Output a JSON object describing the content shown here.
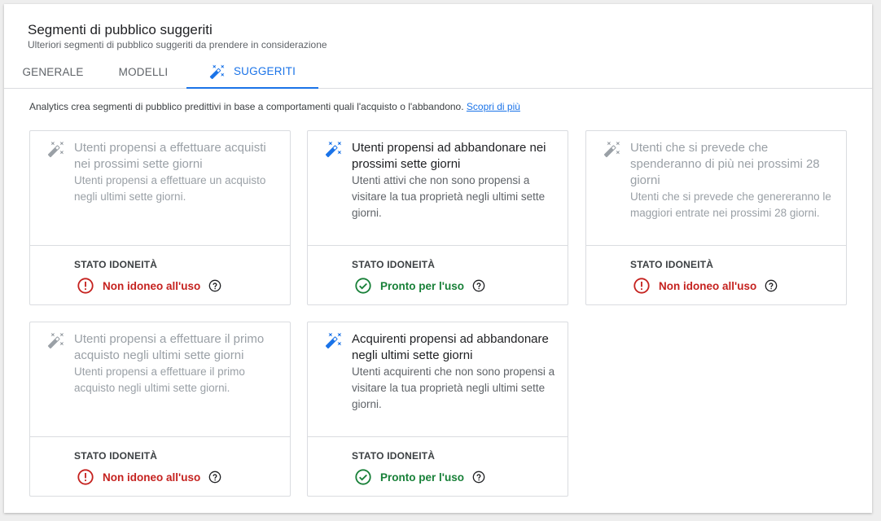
{
  "header": {
    "title": "Segmenti di pubblico suggeriti",
    "subtitle": "Ulteriori segmenti di pubblico suggeriti da prendere in considerazione"
  },
  "tabs": [
    {
      "label": "GENERALE",
      "active": false
    },
    {
      "label": "MODELLI",
      "active": false
    },
    {
      "label": "SUGGERITI",
      "active": true,
      "icon": "magic-wand-icon"
    }
  ],
  "intro": {
    "text": "Analytics crea segmenti di pubblico predittivi in base a comportamenti quali l'acquisto o l'abbandono.",
    "link": "Scopri di più"
  },
  "status_label": "STATO IDONEITÀ",
  "cards": [
    {
      "title": "Utenti propensi a effettuare acquisti nei prossimi sette giorni",
      "description": "Utenti propensi a effettuare un acquisto negli ultimi sette giorni.",
      "status": "Non idoneo all'uso",
      "eligible": false
    },
    {
      "title": "Utenti propensi ad abbandonare nei prossimi sette giorni",
      "description": "Utenti attivi che non sono propensi a visitare la tua proprietà negli ultimi sette giorni.",
      "status": "Pronto per l'uso",
      "eligible": true
    },
    {
      "title": "Utenti che si prevede che spenderanno di più nei prossimi 28 giorni",
      "description": "Utenti che si prevede che genereranno le maggiori entrate nei prossimi 28 giorni.",
      "status": "Non idoneo all'uso",
      "eligible": false
    },
    {
      "title": "Utenti propensi a effettuare il primo acquisto negli ultimi sette giorni",
      "description": "Utenti propensi a effettuare il primo acquisto negli ultimi sette giorni.",
      "status": "Non idoneo all'uso",
      "eligible": false
    },
    {
      "title": "Acquirenti propensi ad abbandonare negli ultimi sette giorni",
      "description": "Utenti acquirenti che non sono propensi a visitare la tua proprietà negli ultimi sette giorni.",
      "status": "Pronto per l'uso",
      "eligible": true
    }
  ],
  "colors": {
    "accent": "#1a73e8",
    "error": "#c5221f",
    "success": "#188038",
    "disabled": "#9aa0a6"
  }
}
